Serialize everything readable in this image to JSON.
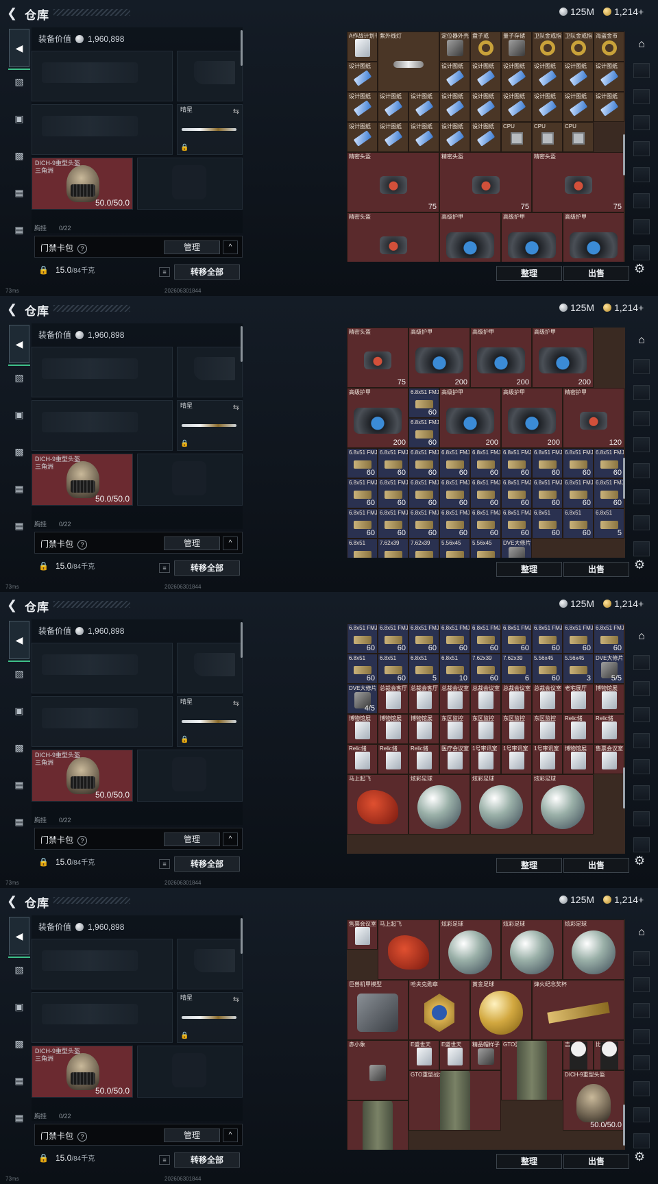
{
  "header": {
    "back_icon": "back-arrow-icon",
    "title": "仓库",
    "silver": "125M",
    "gold": "1,214+"
  },
  "equip": {
    "value_label": "装备价值",
    "value": "1,960,898",
    "knife_label": "晴星",
    "helmet_name": "DICH-9重型头盔",
    "helmet_sub": "三角洲",
    "helmet_dur": "50.0/50.0",
    "chest_label": "胸挂",
    "chest_cap": "0/22"
  },
  "bag": {
    "label": "门禁卡包",
    "help": "?",
    "manage": "管理",
    "collapse": "^"
  },
  "footer": {
    "weight": "15.0",
    "weight_max": "/84千克",
    "list_icon": "≡",
    "transfer_all": "转移全部",
    "ping": "73ms",
    "build": "2026063018​44"
  },
  "inv_buttons": {
    "sort": "整理",
    "sell": "出售"
  },
  "right_tabs": [
    "",
    "",
    "",
    "",
    "",
    "",
    "",
    ""
  ],
  "frames": [
    {
      "cells": [
        {
          "n": "A作战计划书",
          "c": "c-brown",
          "i": "i-card",
          "ct": ""
        },
        {
          "n": "紫外线灯",
          "c": "c-brown",
          "i": "i-light",
          "ct": "",
          "span": 2
        },
        {
          "n": "定位器外壳",
          "c": "c-brown",
          "i": "i-gen",
          "ct": ""
        },
        {
          "n": "盘子戒",
          "c": "c-brown",
          "i": "i-ring",
          "ct": ""
        },
        {
          "n": "量子存储",
          "c": "c-brown",
          "i": "i-gen",
          "ct": ""
        },
        {
          "n": "卫队金戒指",
          "c": "c-brown",
          "i": "i-ring",
          "ct": ""
        },
        {
          "n": "卫队金戒指",
          "c": "c-brown",
          "i": "i-ring",
          "ct": ""
        },
        {
          "n": "海盗金币",
          "c": "c-brown",
          "i": "i-ring",
          "ct": ""
        },
        {
          "n": "设计图纸",
          "c": "c-brown",
          "i": "i-print",
          "ct": ""
        },
        {
          "n": "设计图纸",
          "c": "c-brown",
          "i": "i-print",
          "ct": ""
        },
        {
          "n": "设计图纸",
          "c": "c-brown",
          "i": "i-print",
          "ct": ""
        },
        {
          "n": "设计图纸",
          "c": "c-brown",
          "i": "i-print",
          "ct": ""
        },
        {
          "n": "设计图纸",
          "c": "c-brown",
          "i": "i-print",
          "ct": ""
        },
        {
          "n": "设计图纸",
          "c": "c-brown",
          "i": "i-print",
          "ct": ""
        },
        {
          "n": "设计图纸",
          "c": "c-brown",
          "i": "i-print",
          "ct": ""
        },
        {
          "n": "设计图纸",
          "c": "c-brown",
          "i": "i-print",
          "ct": ""
        },
        {
          "n": "设计图纸",
          "c": "c-brown",
          "i": "i-print",
          "ct": ""
        },
        {
          "n": "设计图纸",
          "c": "c-brown",
          "i": "i-print",
          "ct": ""
        },
        {
          "n": "设计图纸",
          "c": "c-brown",
          "i": "i-print",
          "ct": ""
        },
        {
          "n": "设计图纸",
          "c": "c-brown",
          "i": "i-print",
          "ct": ""
        },
        {
          "n": "设计图纸",
          "c": "c-brown",
          "i": "i-print",
          "ct": ""
        },
        {
          "n": "设计图纸",
          "c": "c-brown",
          "i": "i-print",
          "ct": ""
        },
        {
          "n": "设计图纸",
          "c": "c-brown",
          "i": "i-print",
          "ct": ""
        },
        {
          "n": "设计图纸",
          "c": "c-brown",
          "i": "i-print",
          "ct": ""
        },
        {
          "n": "设计图纸",
          "c": "c-brown",
          "i": "i-print",
          "ct": ""
        },
        {
          "n": "设计图纸",
          "c": "c-brown",
          "i": "i-print",
          "ct": ""
        },
        {
          "n": "设计图纸",
          "c": "c-brown",
          "i": "i-print",
          "ct": ""
        },
        {
          "n": "设计图纸",
          "c": "c-brown",
          "i": "i-print",
          "ct": ""
        },
        {
          "n": "设计图纸",
          "c": "c-brown",
          "i": "i-print",
          "ct": ""
        },
        {
          "n": "CPU",
          "c": "c-brown",
          "i": "i-cpu",
          "ct": ""
        },
        {
          "n": "CPU",
          "c": "c-brown",
          "i": "i-cpu",
          "ct": ""
        },
        {
          "n": "CPU",
          "c": "c-brown",
          "i": "i-cpu",
          "ct": ""
        },
        {
          "n": "精密头盔",
          "c": "c-red",
          "i": "i-case",
          "ct": "75",
          "span": 3
        },
        {
          "n": "精密头盔",
          "c": "c-red",
          "i": "i-case",
          "ct": "75",
          "span": 3
        },
        {
          "n": "精密头盔",
          "c": "c-red",
          "i": "i-case",
          "ct": "75",
          "span": 3
        },
        {
          "n": "精密头盔",
          "c": "c-red",
          "i": "i-case",
          "ct": "75",
          "span": 3
        },
        {
          "n": "高级护甲",
          "c": "c-red",
          "i": "i-bag",
          "ct": "200",
          "span": 2
        },
        {
          "n": "高级护甲",
          "c": "c-red",
          "i": "i-bag",
          "ct": "200",
          "span": 2
        },
        {
          "n": "高级护甲",
          "c": "c-red",
          "i": "i-bag",
          "ct": "200",
          "span": 2
        },
        {
          "n": "高级护甲",
          "c": "c-red",
          "i": "i-bag",
          "ct": "",
          "span": 2
        },
        {
          "n": "6.8x51",
          "c": "c-blue",
          "i": "i-ammo",
          "ct": "60"
        }
      ]
    },
    {
      "cells": [
        {
          "n": "精密头盔",
          "c": "c-red",
          "i": "i-case",
          "ct": "75",
          "span": 2
        },
        {
          "n": "高级护甲",
          "c": "c-red",
          "i": "i-bag",
          "ct": "200",
          "span": 2
        },
        {
          "n": "高级护甲",
          "c": "c-red",
          "i": "i-bag",
          "ct": "200",
          "span": 2
        },
        {
          "n": "高级护甲",
          "c": "c-red",
          "i": "i-bag",
          "ct": "200",
          "span": 2
        },
        {
          "n": "高级护甲",
          "c": "c-red",
          "i": "i-bag",
          "ct": "200",
          "span": 2
        },
        {
          "n": "6.8x51 FMJ",
          "c": "c-blue",
          "i": "i-ammo",
          "ct": "60"
        },
        {
          "n": "高级护甲",
          "c": "c-red",
          "i": "i-bag",
          "ct": "200",
          "span": 2
        },
        {
          "n": "高级护甲",
          "c": "c-red",
          "i": "i-bag",
          "ct": "200",
          "span": 2
        },
        {
          "n": "精密护甲",
          "c": "c-red",
          "i": "i-case",
          "ct": "120",
          "span": 2
        },
        {
          "n": "6.8x51 FMJ",
          "c": "c-blue",
          "i": "i-ammo",
          "ct": "60"
        },
        {
          "n": "6.8x51 FMJ",
          "c": "c-blue",
          "i": "i-ammo",
          "ct": "60"
        },
        {
          "n": "6.8x51 FMJ",
          "c": "c-blue",
          "i": "i-ammo",
          "ct": "60"
        },
        {
          "n": "6.8x51 FMJ",
          "c": "c-blue",
          "i": "i-ammo",
          "ct": "60"
        },
        {
          "n": "6.8x51 FMJ",
          "c": "c-blue",
          "i": "i-ammo",
          "ct": "60"
        },
        {
          "n": "6.8x51 FMJ",
          "c": "c-blue",
          "i": "i-ammo",
          "ct": "60"
        },
        {
          "n": "6.8x51 FMJ",
          "c": "c-blue",
          "i": "i-ammo",
          "ct": "60"
        },
        {
          "n": "6.8x51 FMJ",
          "c": "c-blue",
          "i": "i-ammo",
          "ct": "60"
        },
        {
          "n": "6.8x51 FMJ",
          "c": "c-blue",
          "i": "i-ammo",
          "ct": "60"
        },
        {
          "n": "6.8x51 FMJ",
          "c": "c-blue",
          "i": "i-ammo",
          "ct": "60"
        },
        {
          "n": "6.8x51 FMJ",
          "c": "c-blue",
          "i": "i-ammo",
          "ct": "60"
        },
        {
          "n": "6.8x51 FMJ",
          "c": "c-blue",
          "i": "i-ammo",
          "ct": "60"
        },
        {
          "n": "6.8x51 FMJ",
          "c": "c-blue",
          "i": "i-ammo",
          "ct": "60"
        },
        {
          "n": "6.8x51 FMJ",
          "c": "c-blue",
          "i": "i-ammo",
          "ct": "60"
        },
        {
          "n": "6.8x51 FMJ",
          "c": "c-blue",
          "i": "i-ammo",
          "ct": "60"
        },
        {
          "n": "6.8x51 FMJ",
          "c": "c-blue",
          "i": "i-ammo",
          "ct": "60"
        },
        {
          "n": "6.8x51 FMJ",
          "c": "c-blue",
          "i": "i-ammo",
          "ct": "60"
        },
        {
          "n": "6.8x51 FMJ",
          "c": "c-blue",
          "i": "i-ammo",
          "ct": "60"
        },
        {
          "n": "6.8x51 FMJ",
          "c": "c-blue",
          "i": "i-ammo",
          "ct": "60"
        },
        {
          "n": "6.8x51 FMJ",
          "c": "c-blue",
          "i": "i-ammo",
          "ct": "60"
        },
        {
          "n": "6.8x51 FMJ",
          "c": "c-blue",
          "i": "i-ammo",
          "ct": "60"
        },
        {
          "n": "6.8x51 FMJ",
          "c": "c-blue",
          "i": "i-ammo",
          "ct": "60"
        },
        {
          "n": "6.8x51 FMJ",
          "c": "c-blue",
          "i": "i-ammo",
          "ct": "60"
        },
        {
          "n": "6.8x51 FMJ",
          "c": "c-blue",
          "i": "i-ammo",
          "ct": "60"
        },
        {
          "n": "6.8x51 FMJ",
          "c": "c-blue",
          "i": "i-ammo",
          "ct": "60"
        },
        {
          "n": "6.8x51",
          "c": "c-blue",
          "i": "i-ammo",
          "ct": "60"
        },
        {
          "n": "6.8x51",
          "c": "c-blue",
          "i": "i-ammo",
          "ct": "60"
        },
        {
          "n": "6.8x51",
          "c": "c-blue",
          "i": "i-ammo",
          "ct": "5"
        },
        {
          "n": "6.8x51",
          "c": "c-blue",
          "i": "i-ammo",
          "ct": "10"
        },
        {
          "n": "7.62x39",
          "c": "c-blue",
          "i": "i-ammo",
          "ct": "60"
        },
        {
          "n": "7.62x39",
          "c": "c-blue",
          "i": "i-ammo",
          "ct": "6"
        },
        {
          "n": "5.56x45",
          "c": "c-blue",
          "i": "i-ammo",
          "ct": "60"
        },
        {
          "n": "5.56x45",
          "c": "c-blue",
          "i": "i-ammo",
          "ct": "3"
        },
        {
          "n": "DVE大修片",
          "c": "c-blue",
          "i": "i-gen",
          "ct": "5/5"
        }
      ]
    },
    {
      "cells": [
        {
          "n": "6.8x51 FMJ",
          "c": "c-blue",
          "i": "i-ammo",
          "ct": "60"
        },
        {
          "n": "6.8x51 FMJ",
          "c": "c-blue",
          "i": "i-ammo",
          "ct": "60"
        },
        {
          "n": "6.8x51 FMJ",
          "c": "c-blue",
          "i": "i-ammo",
          "ct": "60"
        },
        {
          "n": "6.8x51 FMJ",
          "c": "c-blue",
          "i": "i-ammo",
          "ct": "60"
        },
        {
          "n": "6.8x51 FMJ",
          "c": "c-blue",
          "i": "i-ammo",
          "ct": "60"
        },
        {
          "n": "6.8x51 FMJ",
          "c": "c-blue",
          "i": "i-ammo",
          "ct": "60"
        },
        {
          "n": "6.8x51 FMJ",
          "c": "c-blue",
          "i": "i-ammo",
          "ct": "60"
        },
        {
          "n": "6.8x51 FMJ",
          "c": "c-blue",
          "i": "i-ammo",
          "ct": "60"
        },
        {
          "n": "6.8x51 FMJ",
          "c": "c-blue",
          "i": "i-ammo",
          "ct": "60"
        },
        {
          "n": "6.8x51",
          "c": "c-blue",
          "i": "i-ammo",
          "ct": "60"
        },
        {
          "n": "6.8x51",
          "c": "c-blue",
          "i": "i-ammo",
          "ct": "60"
        },
        {
          "n": "6.8x51",
          "c": "c-blue",
          "i": "i-ammo",
          "ct": "5"
        },
        {
          "n": "6.8x51",
          "c": "c-blue",
          "i": "i-ammo",
          "ct": "10"
        },
        {
          "n": "7.62x39",
          "c": "c-blue",
          "i": "i-ammo",
          "ct": "60"
        },
        {
          "n": "7.62x39",
          "c": "c-blue",
          "i": "i-ammo",
          "ct": "6"
        },
        {
          "n": "5.56x45",
          "c": "c-blue",
          "i": "i-ammo",
          "ct": "60"
        },
        {
          "n": "5.56x45",
          "c": "c-blue",
          "i": "i-ammo",
          "ct": "3"
        },
        {
          "n": "DVE大修片",
          "c": "c-blue",
          "i": "i-gen",
          "ct": "5/5"
        },
        {
          "n": "DVE大修片",
          "c": "c-blue",
          "i": "i-gen",
          "ct": "4/5"
        },
        {
          "n": "总裁会客厅",
          "c": "c-red",
          "i": "i-card",
          "ct": ""
        },
        {
          "n": "总裁会客厅",
          "c": "c-red",
          "i": "i-card",
          "ct": ""
        },
        {
          "n": "总裁会议室",
          "c": "c-red",
          "i": "i-card",
          "ct": ""
        },
        {
          "n": "总裁会议室",
          "c": "c-red",
          "i": "i-card",
          "ct": ""
        },
        {
          "n": "总裁会议室",
          "c": "c-red",
          "i": "i-card",
          "ct": ""
        },
        {
          "n": "总裁会议室",
          "c": "c-red",
          "i": "i-card",
          "ct": ""
        },
        {
          "n": "老宅展厅",
          "c": "c-red",
          "i": "i-card",
          "ct": ""
        },
        {
          "n": "博物馆展",
          "c": "c-red",
          "i": "i-card",
          "ct": ""
        },
        {
          "n": "博物馆展",
          "c": "c-red",
          "i": "i-card",
          "ct": ""
        },
        {
          "n": "博物馆展",
          "c": "c-red",
          "i": "i-card",
          "ct": ""
        },
        {
          "n": "博物馆展",
          "c": "c-red",
          "i": "i-card",
          "ct": ""
        },
        {
          "n": "东区监控",
          "c": "c-red",
          "i": "i-card",
          "ct": ""
        },
        {
          "n": "东区监控",
          "c": "c-red",
          "i": "i-card",
          "ct": ""
        },
        {
          "n": "东区监控",
          "c": "c-red",
          "i": "i-card",
          "ct": ""
        },
        {
          "n": "东区监控",
          "c": "c-red",
          "i": "i-card",
          "ct": ""
        },
        {
          "n": "Relic储",
          "c": "c-red",
          "i": "i-card",
          "ct": ""
        },
        {
          "n": "Relic储",
          "c": "c-red",
          "i": "i-card",
          "ct": ""
        },
        {
          "n": "Relic储",
          "c": "c-red",
          "i": "i-card",
          "ct": ""
        },
        {
          "n": "Relic储",
          "c": "c-red",
          "i": "i-card",
          "ct": ""
        },
        {
          "n": "Relic储",
          "c": "c-red",
          "i": "i-card",
          "ct": ""
        },
        {
          "n": "医疗会议室",
          "c": "c-red",
          "i": "i-card",
          "ct": ""
        },
        {
          "n": "1号审讯室",
          "c": "c-red",
          "i": "i-card",
          "ct": ""
        },
        {
          "n": "1号审讯室",
          "c": "c-red",
          "i": "i-card",
          "ct": ""
        },
        {
          "n": "1号审讯室",
          "c": "c-red",
          "i": "i-card",
          "ct": ""
        },
        {
          "n": "博物馆展",
          "c": "c-red",
          "i": "i-card",
          "ct": ""
        },
        {
          "n": "售票会议室",
          "c": "c-red",
          "i": "i-card",
          "ct": ""
        },
        {
          "n": "马上起飞",
          "c": "c-red",
          "i": "i-horse",
          "ct": "",
          "span": 2
        },
        {
          "n": "炫彩足球",
          "c": "c-red",
          "i": "i-ball",
          "ct": "",
          "span": 2
        },
        {
          "n": "炫彩足球",
          "c": "c-red",
          "i": "i-ball",
          "ct": "",
          "span": 2
        },
        {
          "n": "炫彩足球",
          "c": "c-red",
          "i": "i-ball",
          "ct": "",
          "span": 2
        }
      ]
    },
    {
      "cells": [
        {
          "n": "售票会议室",
          "c": "c-red",
          "i": "i-card",
          "ct": ""
        },
        {
          "n": "马上起飞",
          "c": "c-red",
          "i": "i-horse",
          "ct": "",
          "span": 2
        },
        {
          "n": "炫彩足球",
          "c": "c-red",
          "i": "i-ball",
          "ct": "",
          "span": 2
        },
        {
          "n": "炫彩足球",
          "c": "c-red",
          "i": "i-ball",
          "ct": "",
          "span": 2
        },
        {
          "n": "炫彩足球",
          "c": "c-red",
          "i": "i-ball",
          "ct": "",
          "span": 2
        },
        {
          "n": "巨兽机甲模型",
          "c": "c-red",
          "i": "i-mech",
          "ct": "",
          "span": 2
        },
        {
          "n": "哈夫克勋章",
          "c": "c-red",
          "i": "i-badge",
          "ct": "",
          "span": 2
        },
        {
          "n": "黄金足球",
          "c": "c-red",
          "i": "i-gball",
          "ct": "",
          "span": 2
        },
        {
          "n": "烽火纪念奖杯",
          "c": "c-red",
          "i": "i-swordh",
          "ct": "",
          "span": 3
        },
        {
          "n": "赤小象",
          "c": "c-red",
          "i": "i-gen",
          "ct": "",
          "span": 2
        },
        {
          "n": "E盛世天",
          "c": "c-red",
          "i": "i-card",
          "ct": ""
        },
        {
          "n": "E盛世天",
          "c": "c-red",
          "i": "i-card",
          "ct": ""
        },
        {
          "n": "精品帽样子",
          "c": "c-red",
          "i": "i-gen",
          "ct": ""
        },
        {
          "n": "GTO重型战术包",
          "c": "c-red",
          "i": "i-pack",
          "ct": "",
          "span": 2
        },
        {
          "n": "吉小福",
          "c": "c-red",
          "i": "i-figure",
          "ct": ""
        },
        {
          "n": "比利的面",
          "c": "c-red",
          "i": "i-figure",
          "ct": ""
        },
        {
          "n": "GTO重型战术包",
          "c": "c-red",
          "i": "i-pack",
          "ct": "",
          "span": 3
        },
        {
          "n": "DICH-9重型头盔",
          "c": "c-red",
          "i": "i-helm",
          "ct": "50.0/50.0",
          "span": 2
        },
        {
          "n": "",
          "c": "c-red",
          "i": "i-pack",
          "ct": "45",
          "span": 2
        }
      ]
    }
  ]
}
